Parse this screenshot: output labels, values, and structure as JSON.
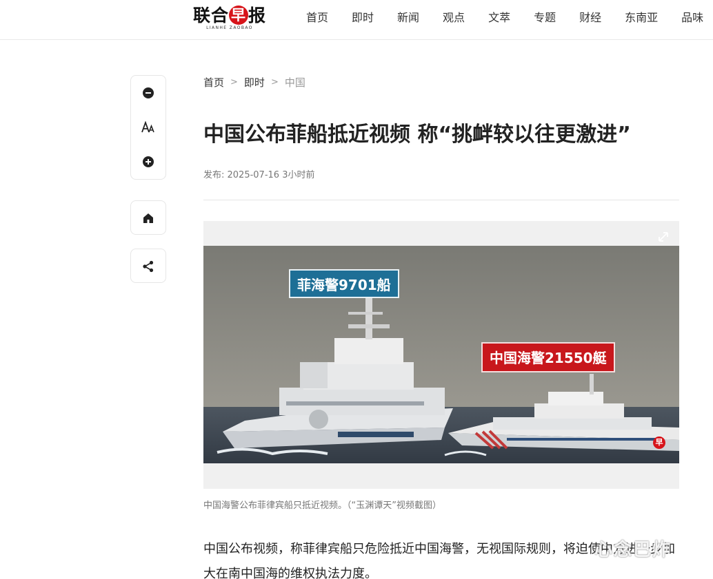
{
  "header": {
    "logo_main_left": "联合",
    "logo_main_red": "早",
    "logo_main_right": "报",
    "logo_sub": "LIANHE ZAOBAO",
    "nav": [
      "首页",
      "即时",
      "新闻",
      "观点",
      "文萃",
      "专题",
      "财经",
      "东南亚",
      "品味"
    ]
  },
  "toolbar": {
    "icons": [
      "zoom-out-icon",
      "font-size-icon",
      "zoom-in-icon",
      "home-icon",
      "share-icon"
    ]
  },
  "breadcrumb": {
    "items": [
      "首页",
      "即时"
    ],
    "separator": ">",
    "current": "中国"
  },
  "article": {
    "title": "中国公布菲船抵近视频 称“挑衅较以往更激进”",
    "meta": "发布: 2025-07-16 3小时前",
    "photo": {
      "label_ph": "菲海警9701船",
      "label_cn": "中国海警21550艇",
      "mark": "早",
      "caption": "中国海警公布菲律宾船只抵近视频。（“玉渊谭天”视频截图）"
    },
    "body": "中国公布视频，称菲律宾船只危险抵近中国海警，无视国际规则，将迫使中方进一步加大在南中国海的维权执法力度。"
  },
  "watermark": "心念巴炸",
  "colors": {
    "brand_red": "#d7141a",
    "ph_label_bg": "#1e6f96",
    "cn_label_bg": "#c8171c"
  }
}
